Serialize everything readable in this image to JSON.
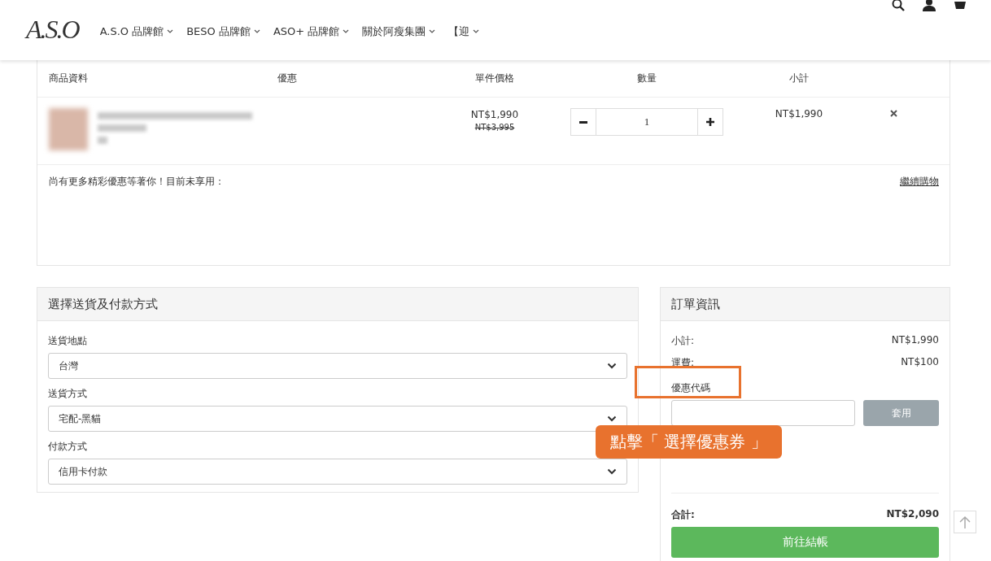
{
  "header": {
    "logo": "A.S.O",
    "nav": [
      {
        "label": "A.S.O 品牌館"
      },
      {
        "label": "BESO 品牌館"
      },
      {
        "label": "ASO+ 品牌館"
      },
      {
        "label": "關於阿瘦集團"
      },
      {
        "label": "【迎"
      }
    ]
  },
  "cart": {
    "columns": [
      "商品資料",
      "優惠",
      "單件價格",
      "數量",
      "小計"
    ],
    "items": [
      {
        "price": "NT$1,990",
        "original_price": "NT$3,995",
        "quantity": "1",
        "subtotal": "NT$1,990"
      }
    ],
    "promo_note": "尚有更多精彩優惠等著你！目前未享用：",
    "continue_link": "繼續購物"
  },
  "shipping": {
    "title": "選擇送貨及付款方式",
    "fields": [
      {
        "label": "送貨地點",
        "value": "台灣"
      },
      {
        "label": "送貨方式",
        "value": "宅配-黑貓"
      },
      {
        "label": "付款方式",
        "value": "信用卡付款"
      }
    ]
  },
  "order": {
    "title": "訂單資訊",
    "lines": [
      {
        "label": "小計:",
        "value": "NT$1,990"
      },
      {
        "label": "運費:",
        "value": "NT$100"
      }
    ],
    "coupon_label": "優惠代碼",
    "apply_button": "套用",
    "total_label": "合計:",
    "total_value": "NT$2,090",
    "checkout_button": "前往結帳"
  },
  "annotation": {
    "callout": "點擊「 選擇優惠券 」"
  }
}
